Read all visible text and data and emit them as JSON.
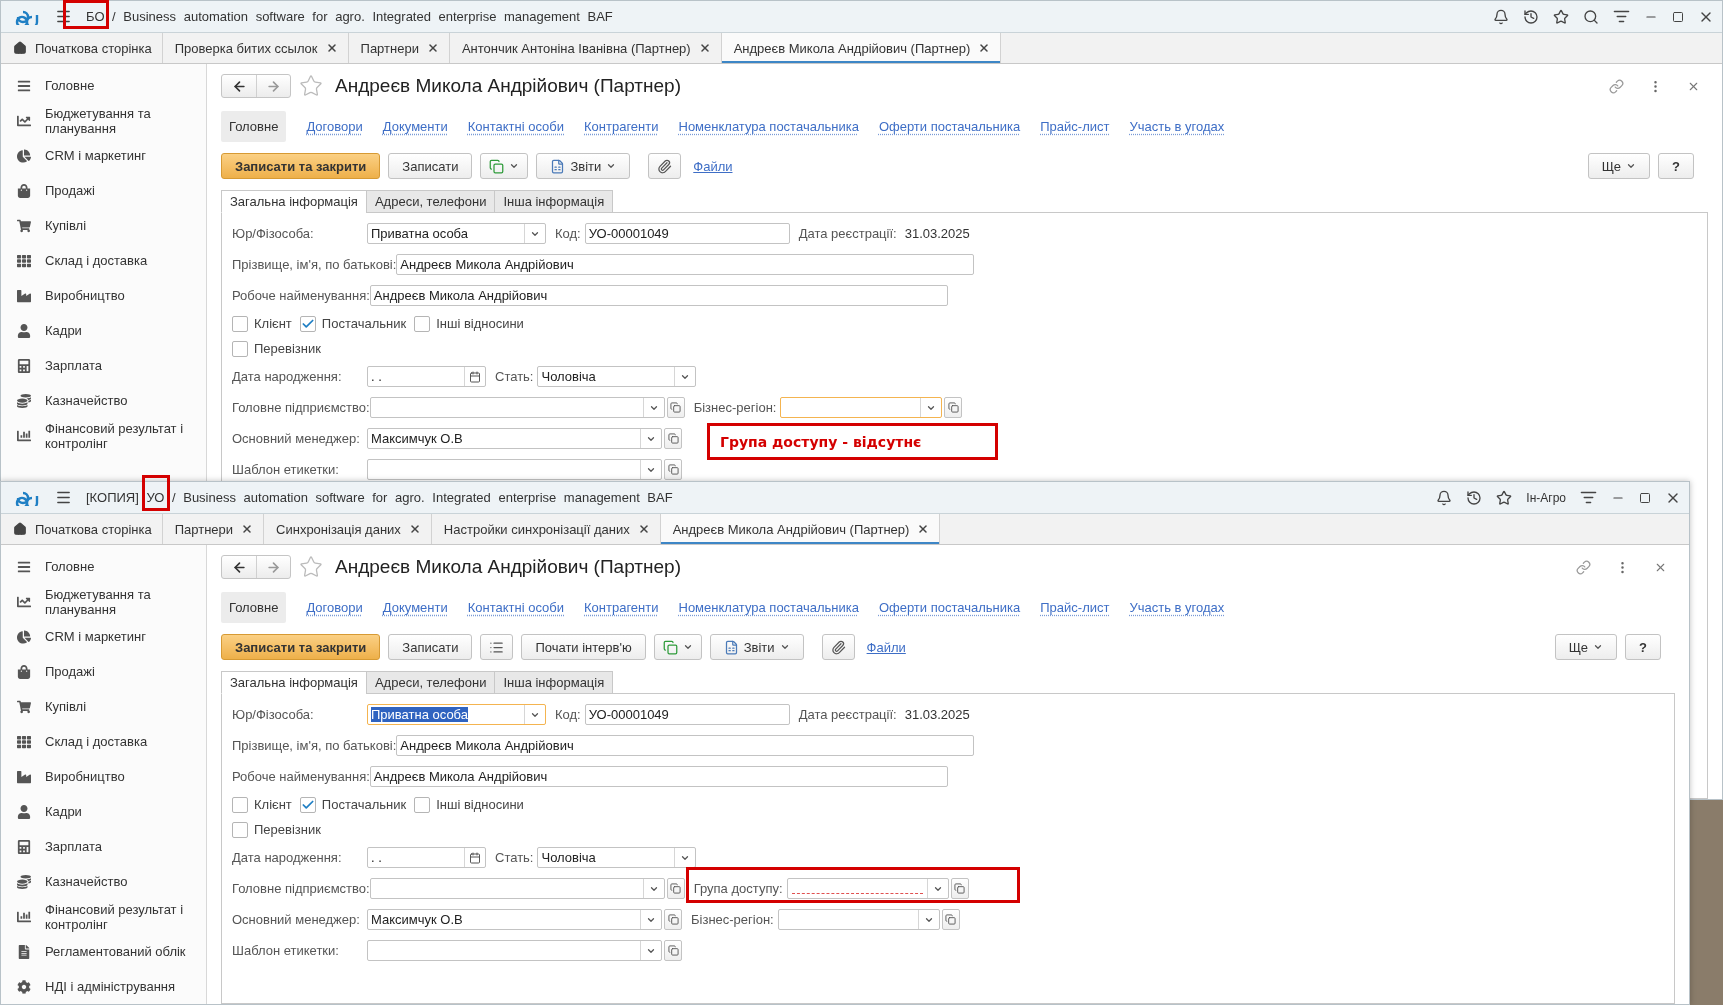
{
  "windows": [
    {
      "title": "БО / Business automation software for agro. Integrated enterprise management BAF",
      "tabs": [
        {
          "kind": "home",
          "label": "Початкова сторінка",
          "selected": false
        },
        {
          "kind": "doc",
          "label": "Проверка битих ссылок",
          "selected": false
        },
        {
          "kind": "doc",
          "label": "Партнери",
          "selected": false
        },
        {
          "kind": "doc",
          "label": "Антончик Антоніна Іванівна (Партнер)",
          "selected": false
        },
        {
          "kind": "doc",
          "label": "Андреєв Микола Андрійович (Партнер)",
          "selected": true
        }
      ],
      "sidebar": [
        {
          "label": "Головне"
        },
        {
          "label": "Бюджетування та планування"
        },
        {
          "label": "CRM і маркетинг"
        },
        {
          "label": "Продажі"
        },
        {
          "label": "Купівлі"
        },
        {
          "label": "Склад і доставка"
        },
        {
          "label": "Виробництво"
        },
        {
          "label": "Кадри"
        },
        {
          "label": "Зарплата"
        },
        {
          "label": "Казначейство"
        },
        {
          "label": "Фінансовий результат і контролінг"
        }
      ],
      "form": {
        "title": "Андреєв Микола Андрійович (Партнер)",
        "sections": [
          {
            "label": "Головне",
            "selected": true
          },
          {
            "label": "Договори",
            "selected": false
          },
          {
            "label": "Документи",
            "selected": false
          },
          {
            "label": "Контактні особи",
            "selected": false
          },
          {
            "label": "Контрагенти",
            "selected": false
          },
          {
            "label": "Номенклатура постачальника",
            "selected": false
          },
          {
            "label": "Оферти постачальника",
            "selected": false
          },
          {
            "label": "Прайс-лист",
            "selected": false
          },
          {
            "label": "Участь в угодах",
            "selected": false
          }
        ],
        "toolbar": [
          {
            "kind": "primary",
            "label": "Записати та закрити"
          },
          {
            "kind": "button",
            "label": "Записати"
          },
          {
            "kind": "copy-menu"
          },
          {
            "kind": "reports",
            "label": "Звіти"
          },
          {
            "kind": "attach"
          },
          {
            "kind": "link",
            "label": "Файли"
          }
        ],
        "toolbar_right": [
          {
            "kind": "more",
            "label": "Ще"
          },
          {
            "kind": "button",
            "label": "?"
          }
        ],
        "tabs": [
          {
            "label": "Загальна інформація",
            "selected": true
          },
          {
            "label": "Адреси, телефони",
            "selected": false
          },
          {
            "label": "Інша інформація",
            "selected": false
          }
        ],
        "rows": [
          {
            "kind": "fields",
            "items": [
              {
                "kind": "combo",
                "label": "Юр/Фізособа:",
                "value": "Приватна особа",
                "focused": false,
                "error": false
              },
              {
                "kind": "text",
                "label": "Код:",
                "value": "УО-00001049",
                "focused": false,
                "error": false
              },
              {
                "kind": "static",
                "label": "Дата реєстрації:",
                "value": "31.03.2025"
              }
            ]
          },
          {
            "kind": "fields",
            "items": [
              {
                "kind": "text",
                "label": "Прізвище, ім'я, по батькові:",
                "value": "Андреєв Микола Андрійович",
                "focused": false,
                "error": false
              }
            ]
          },
          {
            "kind": "fields",
            "items": [
              {
                "kind": "text",
                "label": "Робоче найменування:",
                "value": "Андреєв Микола Андрійович",
                "focused": false,
                "error": false
              }
            ]
          },
          {
            "kind": "checks",
            "items": [
              {
                "label": "Клієнт",
                "checked": false
              },
              {
                "label": "Постачальник",
                "checked": true
              },
              {
                "label": "Інші відносини",
                "checked": false
              }
            ]
          },
          {
            "kind": "checks",
            "items": [
              {
                "label": "Перевізник",
                "checked": false
              }
            ]
          },
          {
            "kind": "fields",
            "items": [
              {
                "kind": "date",
                "label": "Дата народження:",
                "value": ". .",
                "focused": false,
                "error": false
              },
              {
                "kind": "combo",
                "label": "Стать:",
                "value": "Чоловіча",
                "focused": false,
                "error": false
              }
            ]
          },
          {
            "kind": "fields",
            "items": [
              {
                "kind": "ref",
                "label": "Головне підприємство:",
                "value": "",
                "focused": false,
                "error": false
              },
              {
                "kind": "ref",
                "label": "Бізнес-регіон:",
                "value": "",
                "focused": true,
                "error": false
              }
            ]
          },
          {
            "kind": "fields",
            "items": [
              {
                "kind": "ref",
                "label": "Основний менеджер:",
                "value": "Максимчук О.В",
                "focused": false,
                "error": false
              }
            ]
          },
          {
            "kind": "fields",
            "items": [
              {
                "kind": "ref",
                "label": "Шаблон етикетки:",
                "value": "",
                "focused": false,
                "error": false
              }
            ]
          }
        ]
      }
    },
    {
      "title": "[КОПИЯ] УО / Business automation software for agro. Integrated enterprise management BAF",
      "user": "Ін-Агро",
      "tabs": [
        {
          "kind": "home",
          "label": "Початкова сторінка",
          "selected": false
        },
        {
          "kind": "doc",
          "label": "Партнери",
          "selected": false
        },
        {
          "kind": "doc",
          "label": "Синхронізація даних",
          "selected": false
        },
        {
          "kind": "doc",
          "label": "Настройки синхронізації даних",
          "selected": false
        },
        {
          "kind": "doc",
          "label": "Андреєв Микола Андрійович (Партнер)",
          "selected": true
        }
      ],
      "sidebar": [
        {
          "label": "Головне"
        },
        {
          "label": "Бюджетування та планування"
        },
        {
          "label": "CRM і маркетинг"
        },
        {
          "label": "Продажі"
        },
        {
          "label": "Купівлі"
        },
        {
          "label": "Склад і доставка"
        },
        {
          "label": "Виробництво"
        },
        {
          "label": "Кадри"
        },
        {
          "label": "Зарплата"
        },
        {
          "label": "Казначейство"
        },
        {
          "label": "Фінансовий результат і контролінг"
        },
        {
          "label": "Регламентований облік"
        },
        {
          "label": "НДІ і адміністрування"
        }
      ],
      "form": {
        "title": "Андреєв Микола Андрійович (Партнер)",
        "sections": [
          {
            "label": "Головне",
            "selected": true
          },
          {
            "label": "Договори",
            "selected": false
          },
          {
            "label": "Документи",
            "selected": false
          },
          {
            "label": "Контактні особи",
            "selected": false
          },
          {
            "label": "Контрагенти",
            "selected": false
          },
          {
            "label": "Номенклатура постачальника",
            "selected": false
          },
          {
            "label": "Оферти постачальника",
            "selected": false
          },
          {
            "label": "Прайс-лист",
            "selected": false
          },
          {
            "label": "Участь в угодах",
            "selected": false
          }
        ],
        "toolbar": [
          {
            "kind": "primary",
            "label": "Записати та закрити"
          },
          {
            "kind": "button",
            "label": "Записати"
          },
          {
            "kind": "list"
          },
          {
            "kind": "button",
            "label": "Почати інтерв'ю"
          },
          {
            "kind": "copy-menu"
          },
          {
            "kind": "reports",
            "label": "Звіти"
          },
          {
            "kind": "attach"
          },
          {
            "kind": "link",
            "label": "Файли"
          }
        ],
        "toolbar_right": [
          {
            "kind": "more",
            "label": "Ще"
          },
          {
            "kind": "button",
            "label": "?"
          }
        ],
        "tabs": [
          {
            "label": "Загальна інформація",
            "selected": true
          },
          {
            "label": "Адреси, телефони",
            "selected": false
          },
          {
            "label": "Інша інформація",
            "selected": false
          }
        ],
        "rows": [
          {
            "kind": "fields",
            "items": [
              {
                "kind": "combo",
                "label": "Юр/Фізособа:",
                "value": "Приватна особа",
                "focused": true,
                "error": false
              },
              {
                "kind": "text",
                "label": "Код:",
                "value": "УО-00001049",
                "focused": false,
                "error": false
              },
              {
                "kind": "static",
                "label": "Дата реєстрації:",
                "value": "31.03.2025"
              }
            ]
          },
          {
            "kind": "fields",
            "items": [
              {
                "kind": "text",
                "label": "Прізвище, ім'я, по батькові:",
                "value": "Андреєв Микола Андрійович",
                "focused": false,
                "error": false
              }
            ]
          },
          {
            "kind": "fields",
            "items": [
              {
                "kind": "text",
                "label": "Робоче найменування:",
                "value": "Андреєв Микола Андрійович",
                "focused": false,
                "error": false
              }
            ]
          },
          {
            "kind": "checks",
            "items": [
              {
                "label": "Клієнт",
                "checked": false
              },
              {
                "label": "Постачальник",
                "checked": true
              },
              {
                "label": "Інші відносини",
                "checked": false
              }
            ]
          },
          {
            "kind": "checks",
            "items": [
              {
                "label": "Перевізник",
                "checked": false
              }
            ]
          },
          {
            "kind": "fields",
            "items": [
              {
                "kind": "date",
                "label": "Дата народження:",
                "value": ". .",
                "focused": false,
                "error": false
              },
              {
                "kind": "combo",
                "label": "Стать:",
                "value": "Чоловіча",
                "focused": false,
                "error": false
              }
            ]
          },
          {
            "kind": "fields",
            "items": [
              {
                "kind": "ref",
                "label": "Головне підприємство:",
                "value": "",
                "focused": false,
                "error": false
              },
              {
                "kind": "ref",
                "label": "Група доступу:",
                "value": "",
                "focused": false,
                "error": true
              }
            ]
          },
          {
            "kind": "fields",
            "items": [
              {
                "kind": "ref",
                "label": "Основний менеджер:",
                "value": "Максимчук О.В",
                "focused": false,
                "error": false
              },
              {
                "kind": "ref",
                "label": "Бізнес-регіон:",
                "value": "",
                "focused": false,
                "error": false
              }
            ]
          },
          {
            "kind": "fields",
            "items": [
              {
                "kind": "ref",
                "label": "Шаблон етикетки:",
                "value": "",
                "focused": false,
                "error": false
              }
            ]
          }
        ]
      }
    }
  ],
  "annotations": [
    {
      "kind": "frame"
    },
    {
      "kind": "note",
      "text": "Група доступу - відсутнє"
    },
    {
      "kind": "frame"
    },
    {
      "kind": "frame"
    }
  ]
}
